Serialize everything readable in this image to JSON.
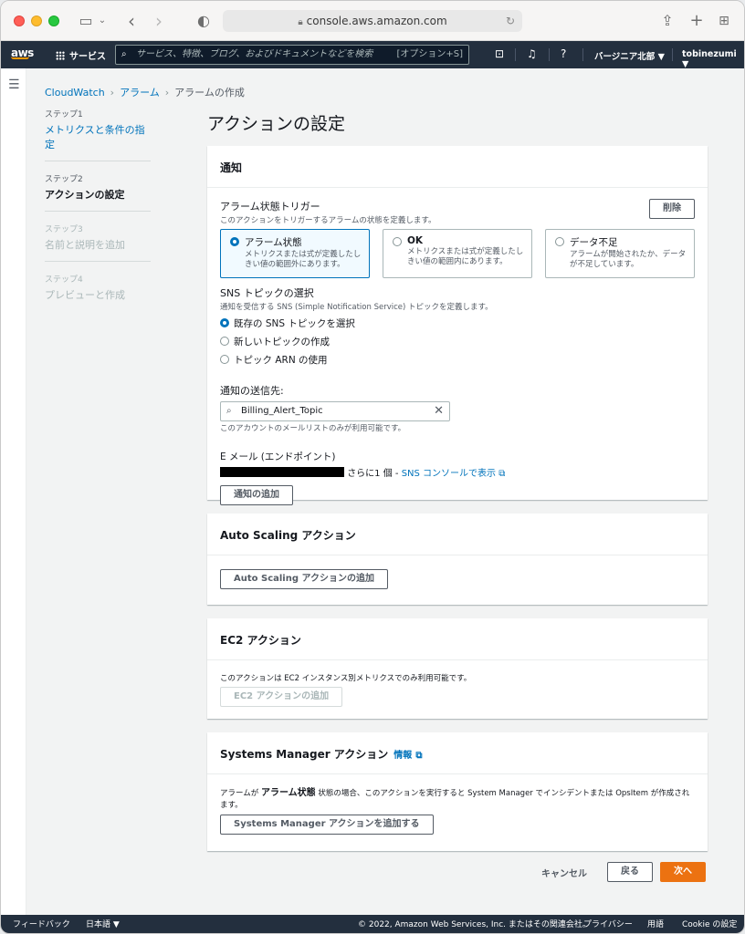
{
  "browser": {
    "url": "console.aws.amazon.com"
  },
  "nav": {
    "logo": "aws",
    "services": "サービス",
    "search_placeholder": "サービス、特徴、ブログ、およびドキュメントなどを検索",
    "search_shortcut": "[オプション+S]",
    "region": "バージニア北部 ▼",
    "user": "tobinezumi ▼"
  },
  "breadcrumb": {
    "root": "CloudWatch",
    "alarms": "アラーム",
    "current": "アラームの作成"
  },
  "steps": [
    {
      "no": "ステップ1",
      "label": "メトリクスと条件の指定"
    },
    {
      "no": "ステップ2",
      "label": "アクションの設定"
    },
    {
      "no": "ステップ3",
      "label": "名前と説明を追加"
    },
    {
      "no": "ステップ4",
      "label": "プレビューと作成"
    }
  ],
  "page_title": "アクションの設定",
  "notification": {
    "header": "通知",
    "trigger_label": "アラーム状態トリガー",
    "trigger_desc": "このアクションをトリガーするアラームの状態を定義します。",
    "remove": "削除",
    "tiles": [
      {
        "title": "アラーム状態",
        "desc": "メトリクスまたは式が定義したしきい値の範囲外にあります。"
      },
      {
        "title": "OK",
        "desc": "メトリクスまたは式が定義したしきい値の範囲内にあります。"
      },
      {
        "title": "データ不足",
        "desc": "アラームが開始されたか、データが不足しています。"
      }
    ],
    "sns_label": "SNS トピックの選択",
    "sns_desc": "通知を受信する SNS (Simple Notification Service) トピックを定義します。",
    "sns_options": [
      "既存の SNS トピックを選択",
      "新しいトピックの作成",
      "トピック ARN の使用"
    ],
    "send_to_label": "通知の送信先:",
    "send_to_value": "Billing_Alert_Topic",
    "send_to_desc": "このアカウントのメールリストのみが利用可能です。",
    "email_label": "E メール (エンドポイント)",
    "email_more": "さらに1 個 - ",
    "email_link": "SNS コンソールで表示",
    "add_button": "通知の追加"
  },
  "autoscaling": {
    "header": "Auto Scaling アクション",
    "button": "Auto Scaling アクションの追加"
  },
  "ec2": {
    "header": "EC2 アクション",
    "desc": "このアクションは EC2 インスタンス別メトリクスでのみ利用可能です。",
    "button": "EC2 アクションの追加"
  },
  "ssm": {
    "header": "Systems Manager アクション",
    "info": "情報",
    "desc_pre": "アラームが ",
    "desc_bold": "アラーム状態",
    "desc_post": " 状態の場合、このアクションを実行すると System Manager でインシデントまたは OpsItem が作成されます。",
    "button": "Systems Manager アクションを追加する"
  },
  "actions": {
    "cancel": "キャンセル",
    "back": "戻る",
    "next": "次へ"
  },
  "footer": {
    "feedback": "フィードバック",
    "language": "日本語 ▼",
    "copyright": "© 2022, Amazon Web Services, Inc. またはその関連会社。",
    "privacy": "プライバシー",
    "terms": "用語",
    "cookie": "Cookie の設定"
  }
}
